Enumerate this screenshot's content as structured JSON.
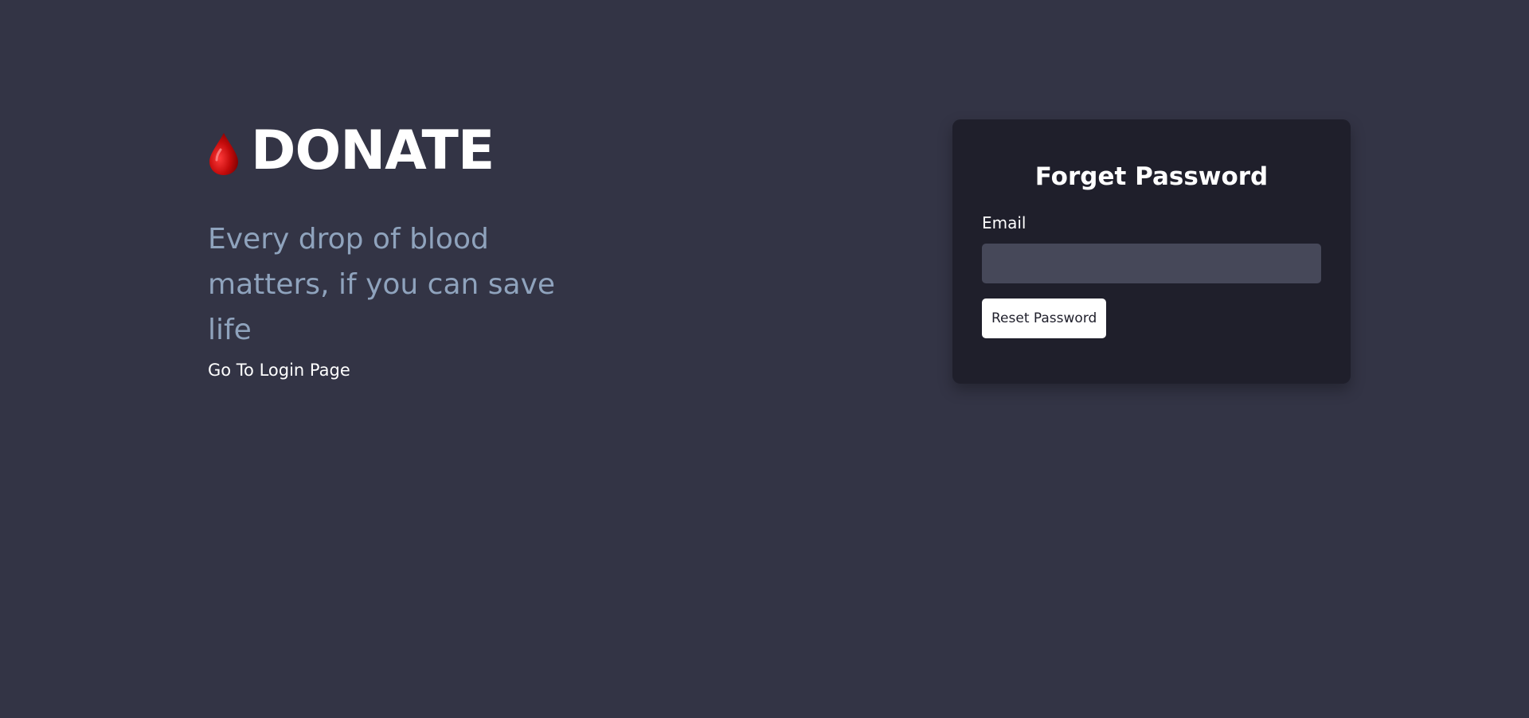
{
  "brand": {
    "icon": "blood-drop-icon",
    "title": "DONATE"
  },
  "hero": {
    "tagline": "Every drop of blood matters, if you can save life",
    "login_link": "Go To Login Page"
  },
  "form": {
    "title": "Forget Password",
    "email_label": "Email",
    "email_value": "",
    "submit_label": "Reset Password"
  },
  "colors": {
    "background": "#333445",
    "card": "#1f1f2b",
    "input": "#464859",
    "tagline": "#8fa3bd",
    "drop": "#c40b0b"
  }
}
